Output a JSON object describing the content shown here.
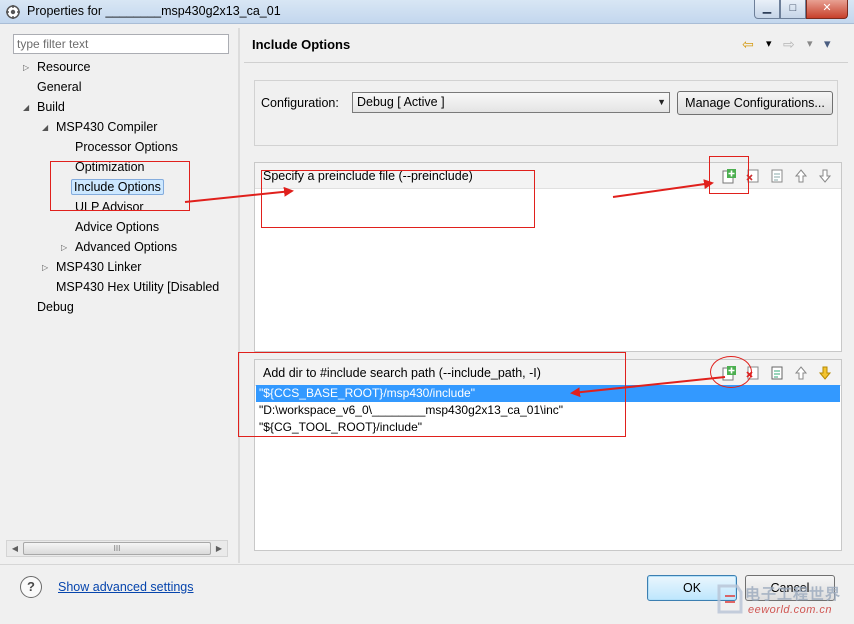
{
  "window": {
    "title": "Properties for ________msp430g2x13_ca_01",
    "minimize": "▁",
    "maximize": "□",
    "close": "✕"
  },
  "sidebar": {
    "filter_placeholder": "type filter text",
    "tree": [
      {
        "label": "Resource",
        "twisty": "▷"
      },
      {
        "label": "General",
        "twisty": ""
      },
      {
        "label": "Build",
        "twisty": "◢"
      },
      {
        "label": "MSP430 Compiler",
        "twisty": "◢"
      },
      {
        "label": "Processor Options",
        "twisty": ""
      },
      {
        "label": "Optimization",
        "twisty": ""
      },
      {
        "label": "Include Options",
        "twisty": "",
        "selected": true
      },
      {
        "label": "ULP Advisor",
        "twisty": ""
      },
      {
        "label": "Advice Options",
        "twisty": ""
      },
      {
        "label": "Advanced Options",
        "twisty": "▷"
      },
      {
        "label": "MSP430 Linker",
        "twisty": "▷"
      },
      {
        "label": "MSP430 Hex Utility  [Disabled",
        "twisty": ""
      },
      {
        "label": "Debug",
        "twisty": ""
      }
    ],
    "scroll_grip": "III"
  },
  "main": {
    "title": "Include Options",
    "nav": {
      "back": "⇦",
      "back_dd": "▾",
      "forward": "⇨",
      "forward_dd": "▾",
      "menu": "▾"
    },
    "configuration_label": "Configuration:",
    "configuration_value": "Debug   [ Active ]",
    "manage_button": "Manage Configurations...",
    "preinclude_panel": {
      "title": "Specify a preinclude file (--preinclude)",
      "items": []
    },
    "include_panel": {
      "title": "Add dir to #include search path (--include_path, -I)",
      "items": [
        "\"${CCS_BASE_ROOT}/msp430/include\"",
        "\"D:\\workspace_v6_0\\________msp430g2x13_ca_01\\inc\"",
        "\"${CG_TOOL_ROOT}/include\""
      ],
      "selected_index": 0
    },
    "tools": [
      "add-icon",
      "delete-icon",
      "edit-icon",
      "move-up-icon",
      "move-down-icon"
    ]
  },
  "footer": {
    "help": "?",
    "advanced_link": "Show advanced settings",
    "ok": "OK",
    "cancel": "Cancel"
  },
  "watermark": {
    "cn": "电子工程世界",
    "en": "eeworld.com.cn"
  },
  "colors": {
    "annotation": "#e0201c",
    "selection": "#3399ff",
    "link": "#0645ad"
  }
}
